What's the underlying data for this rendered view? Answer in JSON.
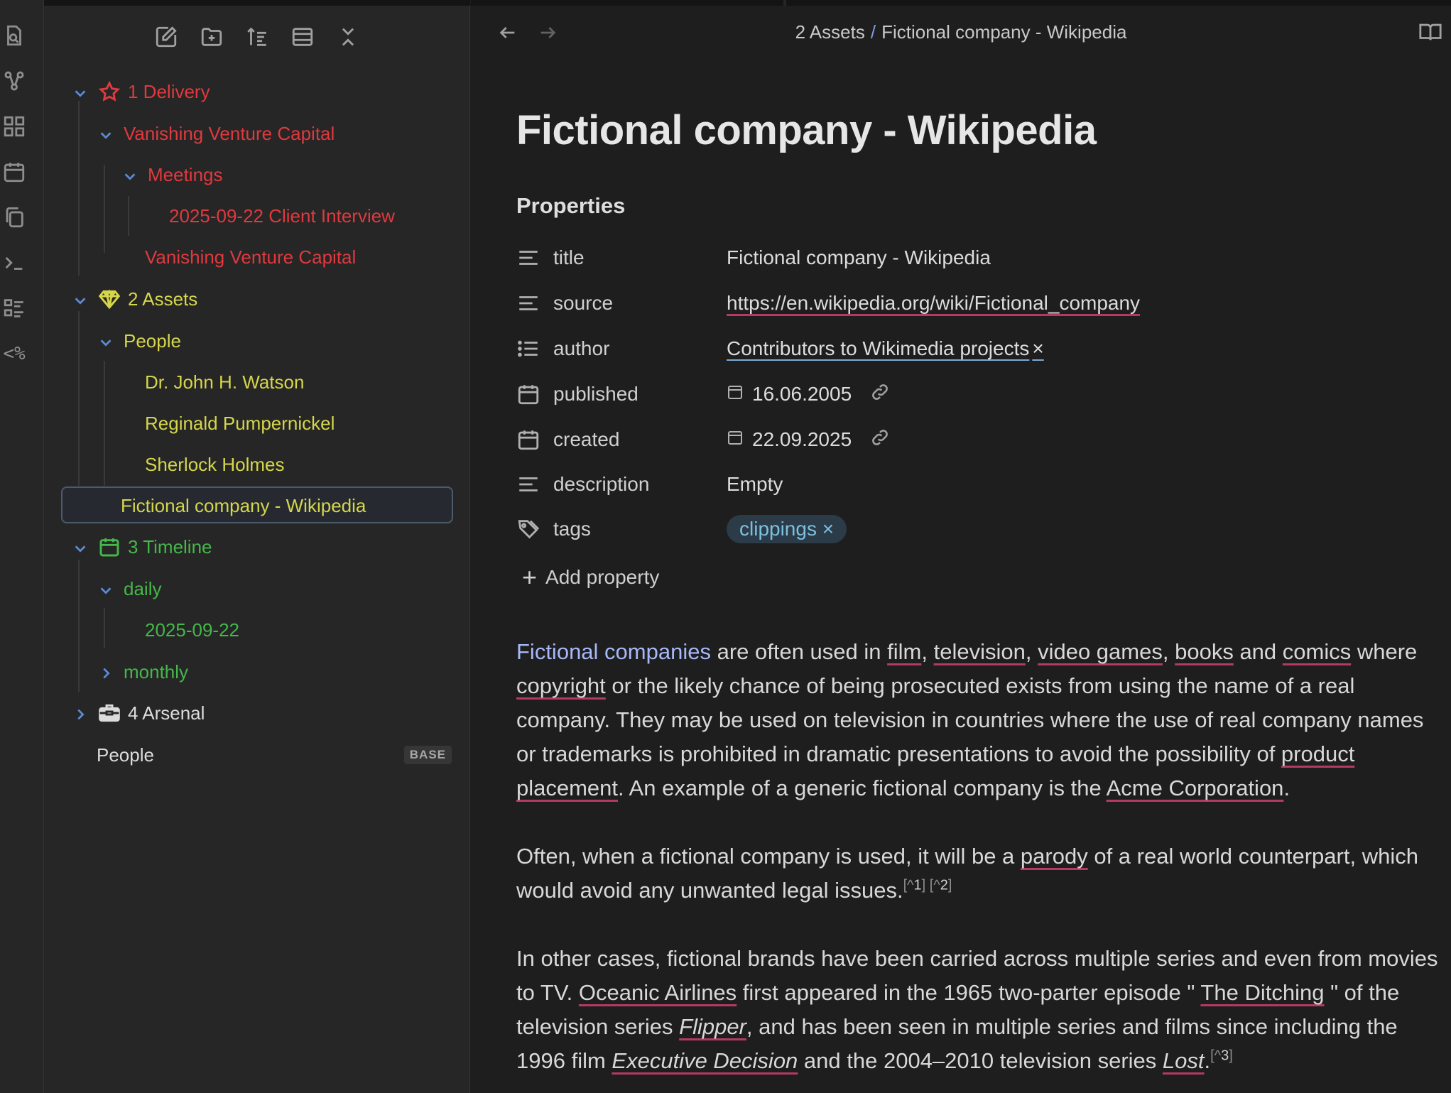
{
  "sidebar": {
    "tree": [
      {
        "id": "delivery",
        "label": "1 Delivery",
        "icon": "star-icon"
      },
      {
        "id": "vvc",
        "label": "Vanishing Venture Capital"
      },
      {
        "id": "meetings",
        "label": "Meetings"
      },
      {
        "id": "interview",
        "label": "2025-09-22 Client Interview"
      },
      {
        "id": "vvc-note",
        "label": "Vanishing Venture Capital"
      },
      {
        "id": "assets",
        "label": "2 Assets",
        "icon": "gem-icon"
      },
      {
        "id": "people-folder",
        "label": "People"
      },
      {
        "id": "watson",
        "label": "Dr. John H. Watson"
      },
      {
        "id": "reginald",
        "label": "Reginald Pumpernickel"
      },
      {
        "id": "sherlock",
        "label": "Sherlock Holmes"
      },
      {
        "id": "fictional",
        "label": "Fictional company - Wikipedia"
      },
      {
        "id": "timeline",
        "label": "3 Timeline",
        "icon": "calendar-icon"
      },
      {
        "id": "daily",
        "label": "daily"
      },
      {
        "id": "daily-note",
        "label": "2025-09-22"
      },
      {
        "id": "monthly",
        "label": "monthly"
      },
      {
        "id": "arsenal",
        "label": "4 Arsenal",
        "icon": "toolbox-icon"
      },
      {
        "id": "people-base",
        "label": "People",
        "badge": "BASE"
      }
    ]
  },
  "header": {
    "breadcrumb_parent": "2 Assets",
    "breadcrumb_sep": "/",
    "breadcrumb_current": "Fictional company - Wikipedia"
  },
  "note": {
    "title": "Fictional company - Wikipedia",
    "properties_heading": "Properties",
    "properties": {
      "title": {
        "key": "title",
        "value": "Fictional company - Wikipedia"
      },
      "source": {
        "key": "source",
        "value": "https://en.wikipedia.org/wiki/Fictional_company"
      },
      "author": {
        "key": "author",
        "value": "Contributors to Wikimedia projects",
        "remove": "×"
      },
      "published": {
        "key": "published",
        "value": "16.06.2005"
      },
      "created": {
        "key": "created",
        "value": "22.09.2025"
      },
      "description": {
        "key": "description",
        "value": "Empty"
      },
      "tags": {
        "key": "tags",
        "value": "clippings",
        "remove": "×"
      }
    },
    "add_property": "Add property",
    "p1": {
      "link": "Fictional companies",
      "t1": " are often used in ",
      "film": "film",
      "c1": ", ",
      "television": "television",
      "c2": ", ",
      "video_games": "video games",
      "c3": ", ",
      "books": "books",
      "t2": " and ",
      "comics": "comics",
      "t3": " where ",
      "copyright": "copyright",
      "t4": " or the likely chance of being prosecuted exists from using the name of a real company. They may be used on television in countries where the use of real company names or trademarks is prohibited in dramatic presentations to avoid the possibility of ",
      "product_placement": "product placement",
      "t5": ". An example of a generic fictional company is the ",
      "acme": "Acme Corporation",
      "t6": "."
    },
    "p2": {
      "t1": "Often, when a fictional company is used, it will be a ",
      "parody": "parody",
      "t2": " of a real world counterpart, which would avoid any unwanted legal issues.",
      "fn1_open": "[^",
      "fn1_num": "1",
      "fn1_close": "] [^",
      "fn2_num": "2",
      "fn2_close": "]"
    },
    "p3": {
      "t1": "In other cases, fictional brands have been carried across multiple series and even from movies to TV. ",
      "oceanic": "Oceanic Airlines",
      "t2": " first appeared in the 1965 two-parter episode \" ",
      "ditching": "The Ditching",
      "t3": " \" of the television series ",
      "flipper": "Flipper",
      "t4": ", and has been seen in multiple series and films since including the 1996 film ",
      "exec": "Executive Decision",
      "t5": " and the 2004–2010 television series ",
      "lost": "Lost",
      "t6": ".",
      "fn3_open": "[^",
      "fn3_num": "3",
      "fn3_close": "]"
    }
  },
  "colors": {
    "delivery": "#e0393e",
    "assets": "#d5d64a",
    "timeline": "#44b84a",
    "accent": "#7a9fe0"
  }
}
